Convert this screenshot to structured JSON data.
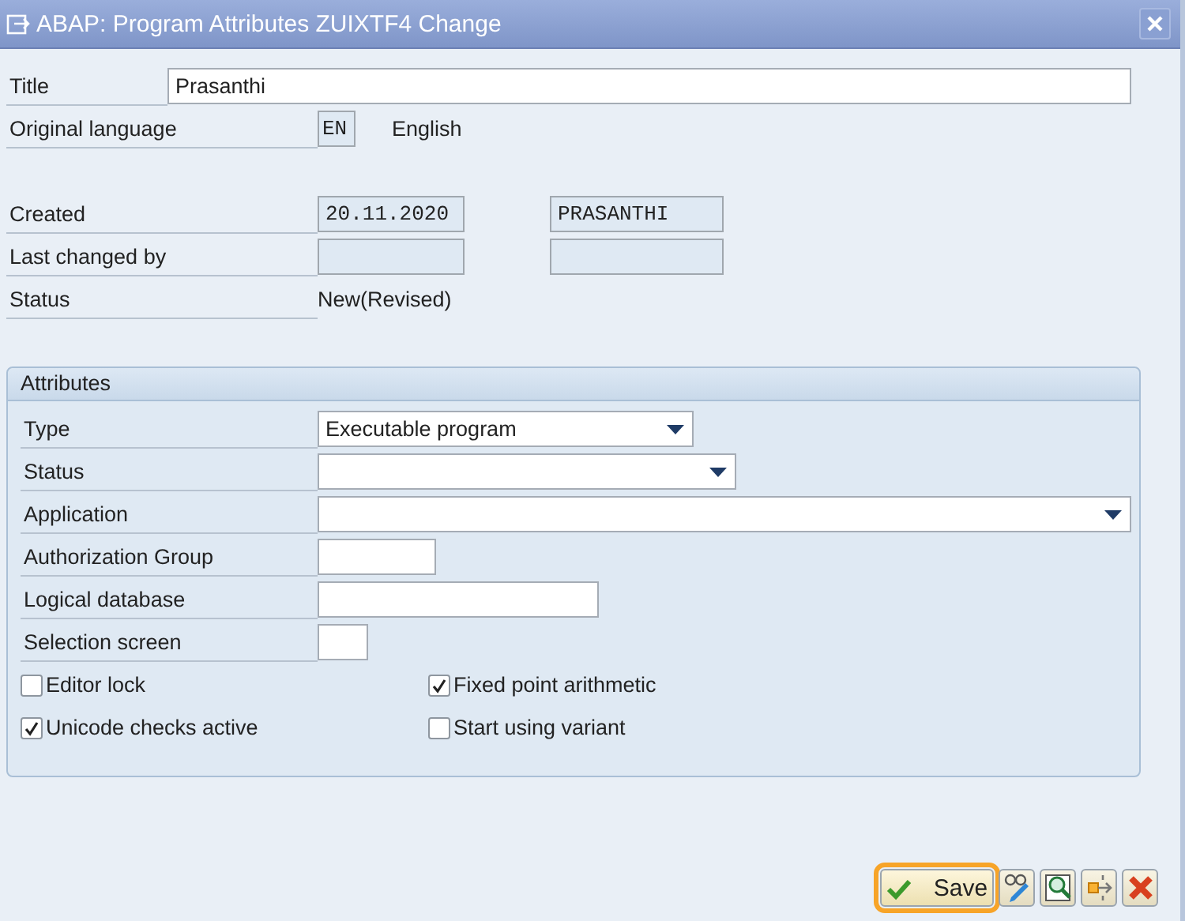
{
  "window": {
    "title": "ABAP: Program Attributes ZUIXTF4 Change"
  },
  "header_fields": [
    {
      "label": "Title",
      "kind": "input",
      "value": "Prasanthi"
    },
    {
      "label": "Original language",
      "kind": "code",
      "value": "EN",
      "description": "English"
    },
    {
      "label": "Created",
      "kind": "readonly_pair",
      "values": [
        "20.11.2020",
        "PRASANTHI"
      ]
    },
    {
      "label": "Last changed by",
      "kind": "empty_pair"
    },
    {
      "label": "Status",
      "kind": "text",
      "value": "New(Revised)"
    }
  ],
  "attributes": {
    "title": "Attributes",
    "fields": [
      {
        "label": "Type",
        "kind": "dropdown",
        "value": "Executable program"
      },
      {
        "label": "Status",
        "kind": "dropdown"
      },
      {
        "label": "Application",
        "kind": "dropdown"
      },
      {
        "label": "Authorization Group",
        "kind": "input"
      },
      {
        "label": "Logical database",
        "kind": "input"
      },
      {
        "label": "Selection screen",
        "kind": "input"
      }
    ],
    "checkboxes": [
      {
        "label": "Editor lock",
        "checked": false
      },
      {
        "label": "Fixed point arithmetic",
        "checked": true
      },
      {
        "label": "Unicode checks active",
        "checked": true
      },
      {
        "label": "Start using variant",
        "checked": false
      }
    ]
  },
  "buttons": [
    {
      "kind": "save",
      "label": "Save",
      "selected": true
    },
    {
      "kind": "glasses",
      "selected": false
    },
    {
      "kind": "find",
      "selected": false
    },
    {
      "kind": "transfer",
      "selected": false
    },
    {
      "kind": "cancel",
      "selected": false
    }
  ]
}
